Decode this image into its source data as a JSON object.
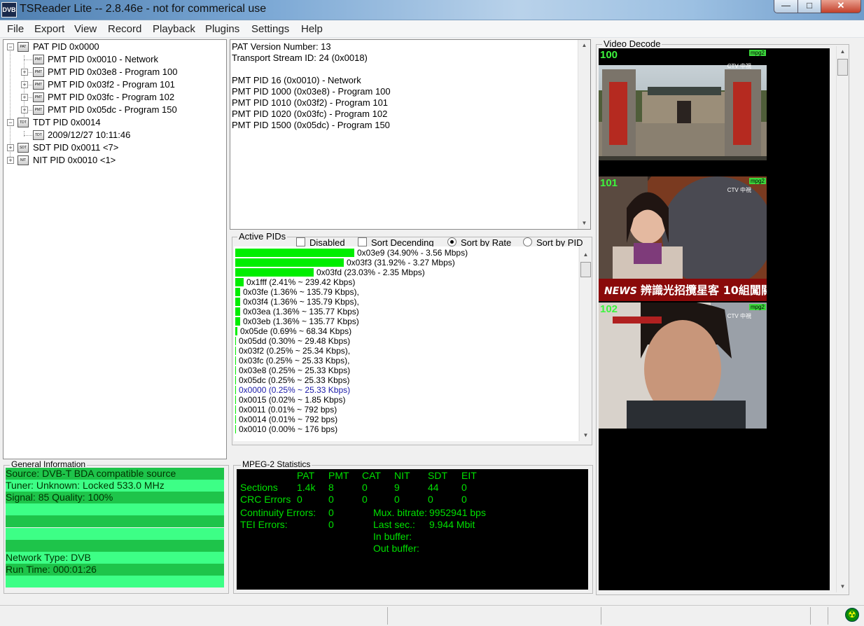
{
  "window": {
    "title": "TSReader Lite -- 2.8.46e - not for commerical use",
    "logo": "DVB"
  },
  "menu": [
    "File",
    "Export",
    "View",
    "Record",
    "Playback",
    "Plugins",
    "Settings",
    "Help"
  ],
  "tree": [
    {
      "icon": "PAT",
      "label": "PAT PID 0x0000"
    },
    {
      "icon": "PMT",
      "label": "PMT PID 0x0010 - Network"
    },
    {
      "icon": "PMT",
      "label": "PMT PID 0x03e8 - Program 100"
    },
    {
      "icon": "PMT",
      "label": "PMT PID 0x03f2 - Program 101"
    },
    {
      "icon": "PMT",
      "label": "PMT PID 0x03fc - Program 102"
    },
    {
      "icon": "PMT",
      "label": "PMT PID 0x05dc - Program 150"
    },
    {
      "icon": "TDT",
      "label": "TDT PID 0x0014"
    },
    {
      "icon": "TDT",
      "label": "2009/12/27 10:11:46"
    },
    {
      "icon": "SDT",
      "label": "SDT PID 0x0011 <7>"
    },
    {
      "icon": "NIT",
      "label": "NIT PID 0x0010 <1>"
    }
  ],
  "info_lines": [
    "PAT Version Number: 13",
    "Transport Stream ID: 24 (0x0018)",
    "",
    "PMT PID 16 (0x0010) - Network",
    "PMT PID 1000 (0x03e8) - Program 100",
    "PMT PID 1010 (0x03f2) - Program 101",
    "PMT PID 1020 (0x03fc) - Program 102",
    "PMT PID 1500 (0x05dc) - Program 150"
  ],
  "active_pids": {
    "legend": "Active PIDs",
    "options": {
      "disabled": "Disabled",
      "sort_desc": "Sort Decending",
      "sort_rate": "Sort by Rate",
      "sort_pid": "Sort by PID"
    },
    "rows": [
      {
        "label": "0x03e9 (34.90% - 3.56 Mbps)",
        "pct": 34.9
      },
      {
        "label": "0x03f3 (31.92% - 3.27 Mbps)",
        "pct": 31.92
      },
      {
        "label": "0x03fd (23.03% - 2.35 Mbps)",
        "pct": 23.03
      },
      {
        "label": "0x1fff (2.41% ~ 239.42 Kbps)",
        "pct": 2.41
      },
      {
        "label": "0x03fe (1.36% ~ 135.79 Kbps),",
        "pct": 1.36
      },
      {
        "label": "0x03f4 (1.36% ~ 135.79 Kbps),",
        "pct": 1.36
      },
      {
        "label": "0x03ea (1.36% ~ 135.77 Kbps)",
        "pct": 1.36
      },
      {
        "label": "0x03eb (1.36% ~ 135.77 Kbps)",
        "pct": 1.36
      },
      {
        "label": "0x05de (0.69% ~ 68.34 Kbps)",
        "pct": 0.69
      },
      {
        "label": "0x05dd (0.30% ~ 29.48 Kbps)",
        "pct": 0.3
      },
      {
        "label": "0x03f2 (0.25% ~ 25.34 Kbps),",
        "pct": 0.25
      },
      {
        "label": "0x03fc (0.25% ~ 25.33 Kbps),",
        "pct": 0.25
      },
      {
        "label": "0x03e8 (0.25% ~ 25.33 Kbps)",
        "pct": 0.25
      },
      {
        "label": "0x05dc (0.25% ~ 25.33 Kbps)",
        "pct": 0.25
      },
      {
        "label": "0x0000 (0.25% ~ 25.33 Kbps)",
        "pct": 0.25,
        "color": "#1a1aa8"
      },
      {
        "label": "0x0015 (0.02% ~ 1.85 Kbps)",
        "pct": 0.02
      },
      {
        "label": "0x0011 (0.01% ~ 792 bps)",
        "pct": 0.01
      },
      {
        "label": "0x0014 (0.01% ~ 792 bps)",
        "pct": 0.01
      },
      {
        "label": "0x0010 (0.00% ~ 176 bps)",
        "pct": 0.0
      }
    ]
  },
  "general": {
    "legend": "General Information",
    "rows": [
      "Source: DVB-T BDA compatible source",
      "Tuner: Unknown: Locked 533.0 MHz",
      "Signal: 85 Quality: 100%",
      "",
      "",
      "",
      "",
      "Network Type: DVB",
      "Run Time: 000:01:26",
      ""
    ],
    "colors": [
      "#1ec44a",
      "#3dff86"
    ]
  },
  "mpeg": {
    "legend": "MPEG-2 Statistics",
    "columns": [
      "PAT",
      "PMT",
      "CAT",
      "NIT",
      "SDT",
      "EIT"
    ],
    "rows": [
      {
        "label": "Sections",
        "values": [
          "1.4k",
          "8",
          "0",
          "9",
          "44",
          "0"
        ]
      },
      {
        "label": "CRC Errors",
        "values": [
          "0",
          "0",
          "0",
          "0",
          "0",
          "0"
        ]
      }
    ],
    "continuity_label": "Continuity Errors:",
    "continuity_value": "0",
    "tei_label": "TEI Errors:",
    "tei_value": "0",
    "mux_label": "Mux. bitrate:",
    "mux_value": "9952941 bps",
    "last_label": "Last sec.:",
    "last_value": "9.944 Mbit",
    "inbuffer_label": "In buffer:",
    "outbuffer_label": "Out buffer:"
  },
  "video": {
    "legend": "Video Decode",
    "thumbs": [
      {
        "program": "100",
        "badge": "mpg2",
        "logo": "CTV 中視"
      },
      {
        "program": "101",
        "badge": "mpg2",
        "logo": "CTV 中視"
      },
      {
        "program": "102",
        "badge": "mpg2",
        "logo": "CTV 中視"
      }
    ]
  },
  "colors": {
    "bar": "#00ee00",
    "stats_text": "#00e000"
  }
}
